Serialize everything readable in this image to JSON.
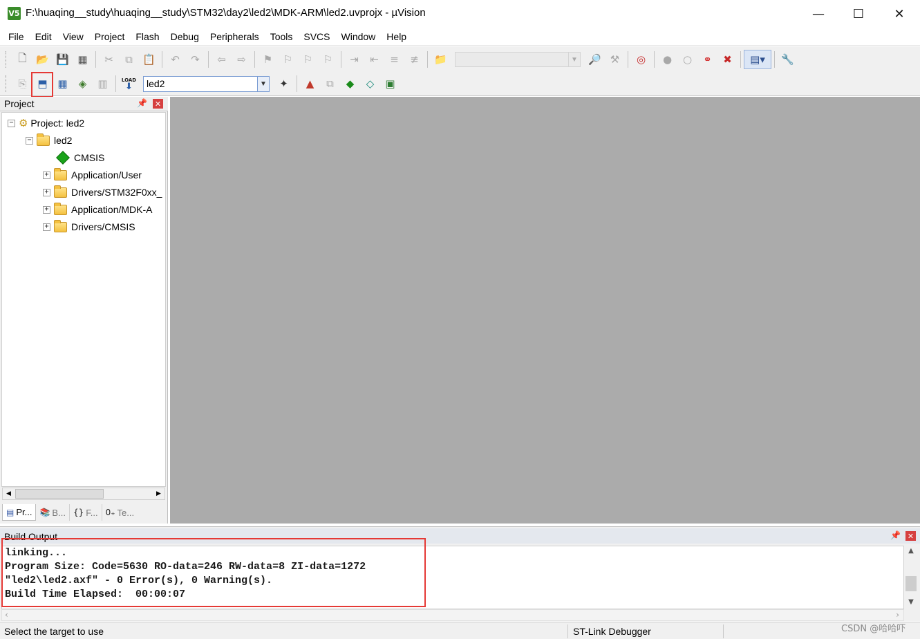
{
  "window": {
    "app_icon_label": "V5",
    "title": "F:\\huaqing__study\\huaqing__study\\STM32\\day2\\led2\\MDK-ARM\\led2.uvprojx - µVision",
    "controls": {
      "minimize": "—",
      "maximize": "☐",
      "close": "✕"
    }
  },
  "menu": [
    "File",
    "Edit",
    "View",
    "Project",
    "Flash",
    "Debug",
    "Peripherals",
    "Tools",
    "SVCS",
    "Window",
    "Help"
  ],
  "toolbar": {
    "target_value": "led2",
    "load_label": "LOAD"
  },
  "project_panel": {
    "title": "Project",
    "tree": {
      "root": "Project: led2",
      "target": "led2",
      "items": [
        "CMSIS",
        "Application/User",
        "Drivers/STM32F0xx_",
        "Application/MDK-A",
        "Drivers/CMSIS"
      ]
    },
    "tabs": [
      "Pr...",
      "B...",
      "F...",
      "Te..."
    ]
  },
  "build_output": {
    "title": "Build Output",
    "lines": [
      "linking...",
      "Program Size: Code=5630 RO-data=246 RW-data=8 ZI-data=1272",
      "\"led2\\led2.axf\" - 0 Error(s), 0 Warning(s).",
      "Build Time Elapsed:  00:00:07"
    ]
  },
  "status": {
    "left": "Select the target to use",
    "debugger": "ST-Link Debugger"
  },
  "watermark": "CSDN @哈哈吓",
  "colors": {
    "highlight": "#e53935",
    "editor_bg": "#ababab",
    "close_red": "#d64040"
  }
}
